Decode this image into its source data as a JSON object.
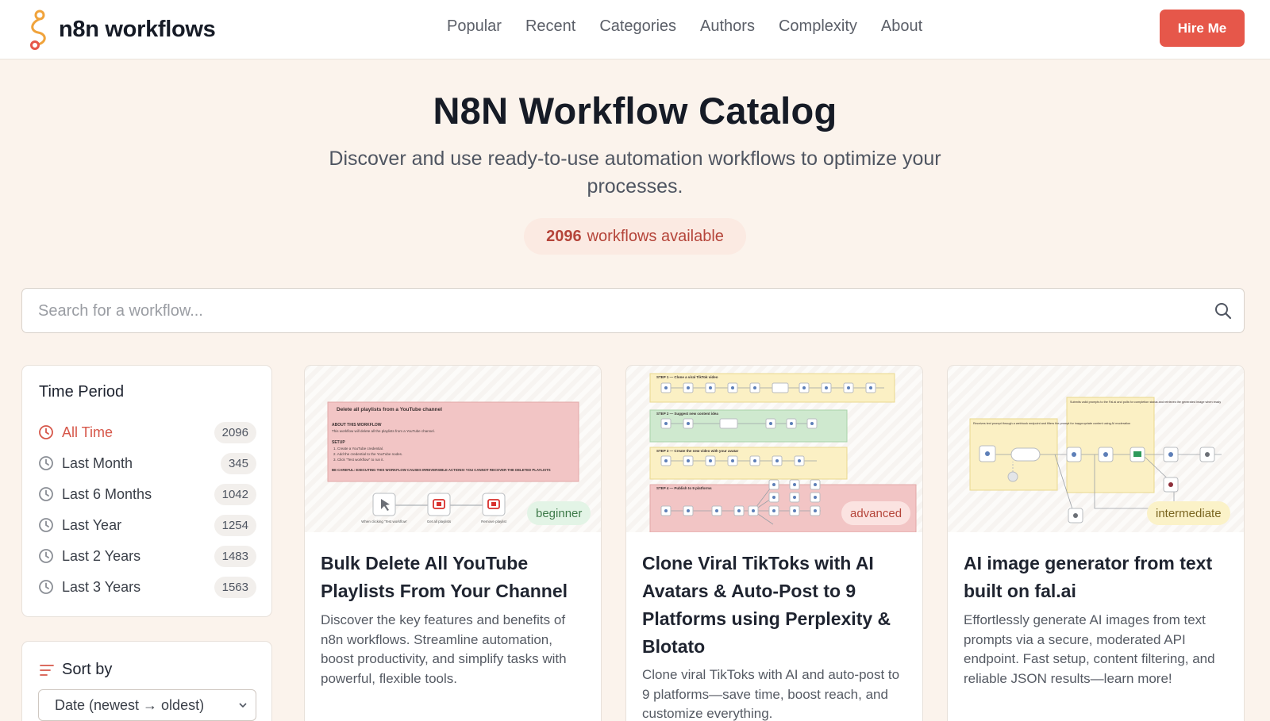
{
  "header": {
    "logo_text": "n8n workflows",
    "nav": [
      "Popular",
      "Recent",
      "Categories",
      "Authors",
      "Complexity",
      "About"
    ],
    "cta": "Hire Me"
  },
  "hero": {
    "title": "N8N Workflow Catalog",
    "subtitle": "Discover and use ready-to-use automation workflows to optimize your processes.",
    "count": "2096",
    "count_label": "workflows available"
  },
  "search": {
    "placeholder": "Search for a workflow..."
  },
  "sidebar": {
    "time_title": "Time Period",
    "periods": [
      {
        "label": "All Time",
        "count": "2096",
        "active": true
      },
      {
        "label": "Last Month",
        "count": "345",
        "active": false
      },
      {
        "label": "Last 6 Months",
        "count": "1042",
        "active": false
      },
      {
        "label": "Last Year",
        "count": "1254",
        "active": false
      },
      {
        "label": "Last 2 Years",
        "count": "1483",
        "active": false
      },
      {
        "label": "Last 3 Years",
        "count": "1563",
        "active": false
      }
    ],
    "sort_title": "Sort by",
    "sort_value": "Date (newest → oldest)"
  },
  "cards": [
    {
      "title": "Bulk Delete All YouTube Playlists From Your Channel",
      "description": "Discover the key features and benefits of n8n workflows. Streamline automation, boost productivity, and simplify tasks with powerful, flexible tools.",
      "level": "beginner",
      "thumb_note_title": "Delete all playlists from a YouTube channel",
      "thumb_about": "ABOUT THIS WORKFLOW",
      "thumb_about_line": "This workflow will delete all the playlists from a YouTube channel.",
      "thumb_setup": "SETUP",
      "thumb_steps": [
        "1. Create a YouTube credential.",
        "2. Add the credential to the YouTube nodes.",
        "3. Click \"Test workflow\" to run it."
      ],
      "thumb_warning": "BE CAREFUL: EXECUTING THIS WORKFLOW CAUSES IRREVERSIBLE ACTIONS! YOU CANNOT RECOVER THE DELETED PLAYLISTS",
      "thumb_nodes": [
        "When clicking 'Test workflow'",
        "Get all playlists",
        "Remove playlist"
      ]
    },
    {
      "title": "Clone Viral TikToks with AI Avatars & Auto-Post to 9 Platforms using Perplexity & Blotato",
      "description": "Clone viral TikToks with AI and auto-post to 9 platforms—save time, boost reach, and customize everything.",
      "level": "advanced",
      "thumb_steps": [
        "STEP 1 — Clone a viral TikTok video",
        "STEP 2 — Suggest new content idea",
        "STEP 3 — Create the new video with your avatar",
        "STEP 4 — Publish to 9 platforms"
      ]
    },
    {
      "title": "AI image generator from text built on fal.ai",
      "description": "Effortlessly generate AI images from text prompts via a secure, moderated API endpoint. Fast setup, content filtering, and reliable JSON results—learn more!",
      "level": "intermediate",
      "thumb_note_left": "Receives text prompt through a webhook endpoint and filters the prompt for inappropriate content using AI moderation",
      "thumb_note_right": "Submits valid prompts to the Fal.ai and polls for completion status and retrieves the generated image when ready"
    }
  ]
}
